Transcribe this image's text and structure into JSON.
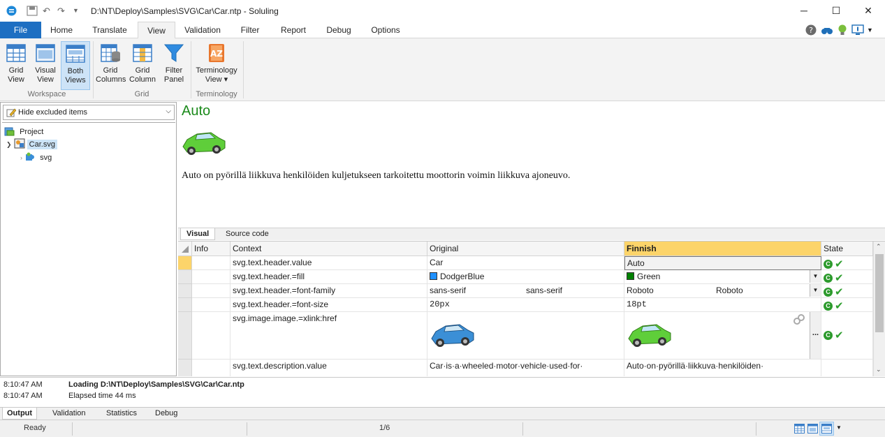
{
  "window": {
    "title": "D:\\NT\\Deploy\\Samples\\SVG\\Car\\Car.ntp  -  Soluling",
    "minimize": "─",
    "maximize": "☐",
    "close": "✕"
  },
  "ribbon_tabs": [
    "File",
    "Home",
    "Translate",
    "View",
    "Validation",
    "Filter",
    "Report",
    "Debug",
    "Options"
  ],
  "ribbon": {
    "grid_view": [
      "Grid",
      "View"
    ],
    "visual_view": [
      "Visual",
      "View"
    ],
    "both_views": [
      "Both",
      "Views"
    ],
    "grid_columns": [
      "Grid",
      "Columns"
    ],
    "grid_column": [
      "Grid",
      "Column"
    ],
    "filter_panel": [
      "Filter",
      "Panel"
    ],
    "terminology_view": [
      "Terminology",
      "View ▾"
    ],
    "groups": [
      "Workspace",
      "Grid",
      "Terminology"
    ]
  },
  "left_panel": {
    "filter_value": "Hide excluded items",
    "tree": [
      "Project",
      "Car.svg",
      "svg"
    ]
  },
  "preview": {
    "title": "Auto",
    "description": "Auto on pyörillä liikkuva henkilöiden kuljetukseen tarkoitettu moottorin voimin liikkuva ajoneuvo."
  },
  "view_tabs": [
    "Visual",
    "Source code"
  ],
  "grid": {
    "headers": [
      "Info",
      "Context",
      "Original",
      "Finnish",
      "State"
    ],
    "rows": [
      {
        "context": "svg.text.header.value",
        "original": "Car",
        "finnish": "Auto"
      },
      {
        "context": "svg.text.header.=fill",
        "original": "DodgerBlue",
        "finnish": "Green"
      },
      {
        "context": "svg.text.header.=font-family",
        "original": "sans-serif",
        "original_preview": "sans-serif",
        "finnish": "Roboto",
        "finnish_preview": "Roboto"
      },
      {
        "context": "svg.text.header.=font-size",
        "original": "20px",
        "finnish": "18pt"
      },
      {
        "context": "svg.image.image.=xlink:href",
        "original": "",
        "finnish": ""
      },
      {
        "context": "svg.text.description.value",
        "original": "Car·is·a·wheeled·motor·vehicle·used·for·",
        "finnish": "Auto·on·pyörillä·liikkuva·henkilöiden·"
      }
    ],
    "state_code": "C",
    "ellipsis": "...",
    "colors": {
      "dodgerblue": "#1e90ff",
      "green": "#008000"
    }
  },
  "output": {
    "entries": [
      {
        "time": "8:10:47 AM",
        "message": "Loading D:\\NT\\Deploy\\Samples\\SVG\\Car\\Car.ntp"
      },
      {
        "time": "8:10:47 AM",
        "message": "Elapsed time 44 ms"
      }
    ]
  },
  "output_tabs": [
    "Output",
    "Validation",
    "Statistics",
    "Debug"
  ],
  "status": {
    "text": "Ready",
    "position": "1/6"
  }
}
